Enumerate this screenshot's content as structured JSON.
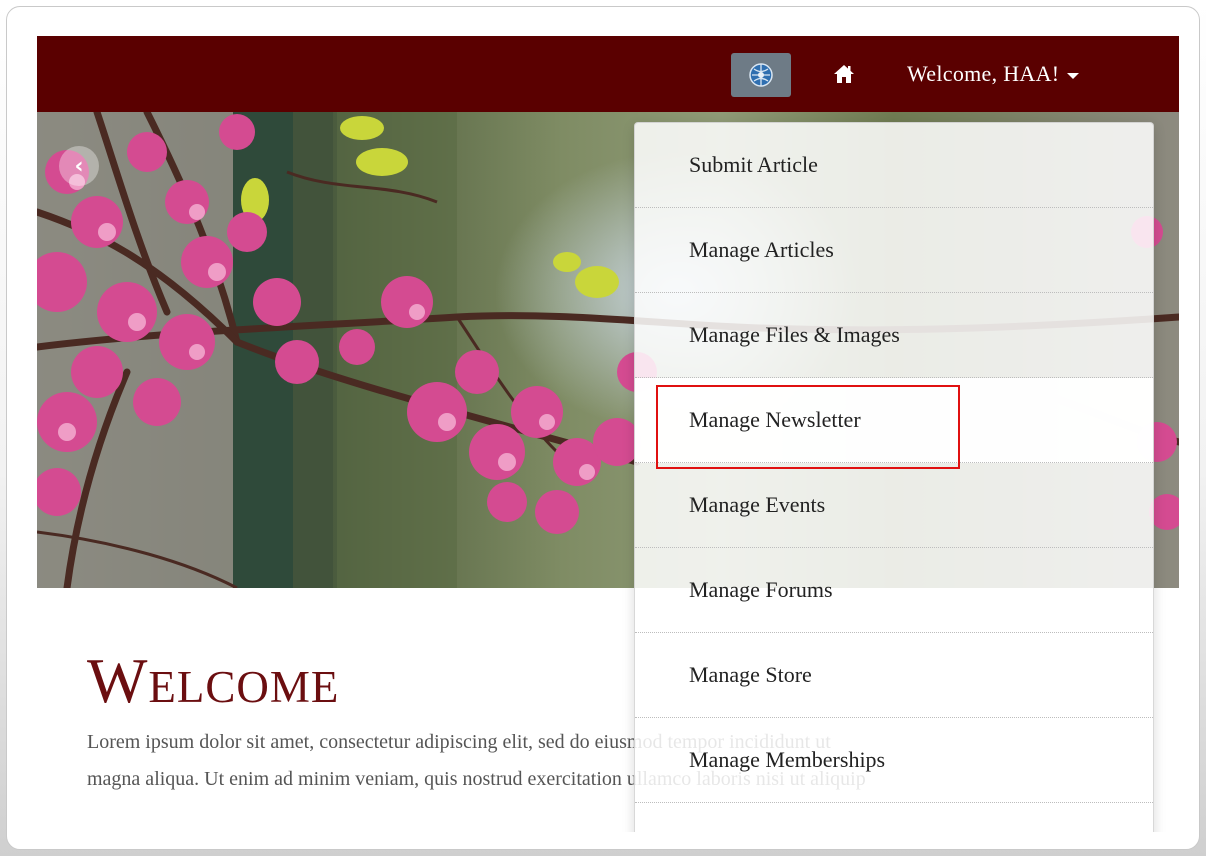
{
  "navbar": {
    "logo_icon": "globe-logo-icon",
    "home_icon": "home-icon",
    "welcome_label": "Welcome, HAA!",
    "colors": {
      "bar": "#5a0000",
      "logo_button": "#6e7b86"
    }
  },
  "hero": {
    "prev_icon": "chevron-left-icon",
    "prev_glyph": "‹"
  },
  "main": {
    "title": "Welcome",
    "paragraph_line1": "Lorem ipsum dolor sit amet, consectetur adipiscing elit, sed do eiusmod tempor incididunt ut",
    "paragraph_line2": "magna aliqua. Ut enim ad minim veniam, quis nostrud exercitation ullamco laboris nisi ut aliquip"
  },
  "dropdown": {
    "items": [
      {
        "label": "Submit Article"
      },
      {
        "label": "Manage Articles"
      },
      {
        "label": "Manage Files & Images"
      },
      {
        "label": "Manage Newsletter"
      },
      {
        "label": "Manage Events"
      },
      {
        "label": "Manage Forums"
      },
      {
        "label": "Manage Store"
      },
      {
        "label": "Manage Memberships"
      }
    ],
    "highlighted_item": "Manage Newsletter",
    "highlight_color": "#e01010"
  }
}
